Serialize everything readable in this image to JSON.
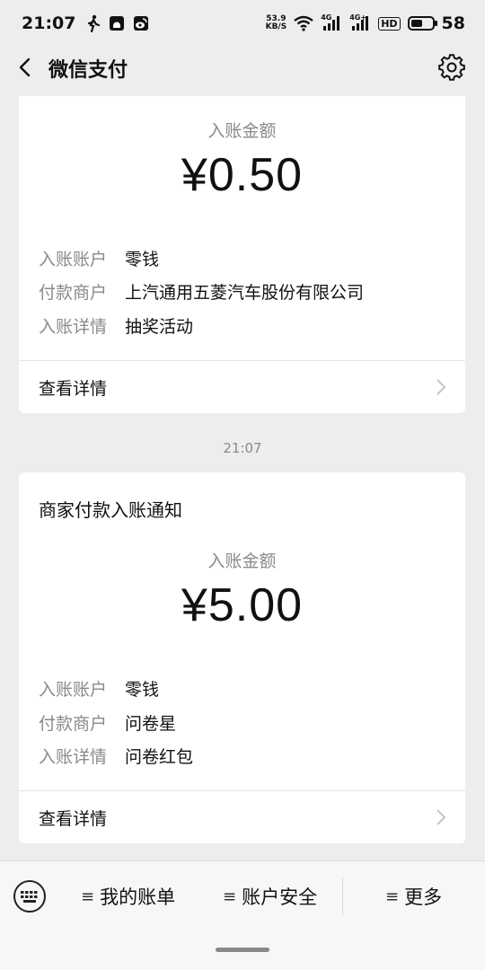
{
  "status_bar": {
    "time": "21:07",
    "network_speed_top": "53.9",
    "network_speed_bottom": "KB/S",
    "network_label_1": "4G",
    "network_label_2": "4G+",
    "hd_label": "HD",
    "battery": "58"
  },
  "header": {
    "title": "微信支付",
    "back_icon": "chevron-left-icon",
    "settings_icon": "gear-icon"
  },
  "cards": [
    {
      "amount_label": "入账金额",
      "amount": "¥0.50",
      "rows": [
        {
          "key": "入账账户",
          "value": "零钱"
        },
        {
          "key": "付款商户",
          "value": "上汽通用五菱汽车股份有限公司"
        },
        {
          "key": "入账详情",
          "value": "抽奖活动"
        }
      ],
      "link": "查看详情"
    },
    {
      "title": "商家付款入账通知",
      "amount_label": "入账金额",
      "amount": "¥5.00",
      "rows": [
        {
          "key": "入账账户",
          "value": "零钱"
        },
        {
          "key": "付款商户",
          "value": "问卷星"
        },
        {
          "key": "入账详情",
          "value": "问卷红包"
        }
      ],
      "link": "查看详情"
    }
  ],
  "timestamp": "21:07",
  "bottom_menu": {
    "keyboard_icon": "keyboard-icon",
    "items": [
      {
        "label": "我的账单"
      },
      {
        "label": "账户安全"
      },
      {
        "label": "更多"
      }
    ],
    "menu_glyph": "≡"
  }
}
